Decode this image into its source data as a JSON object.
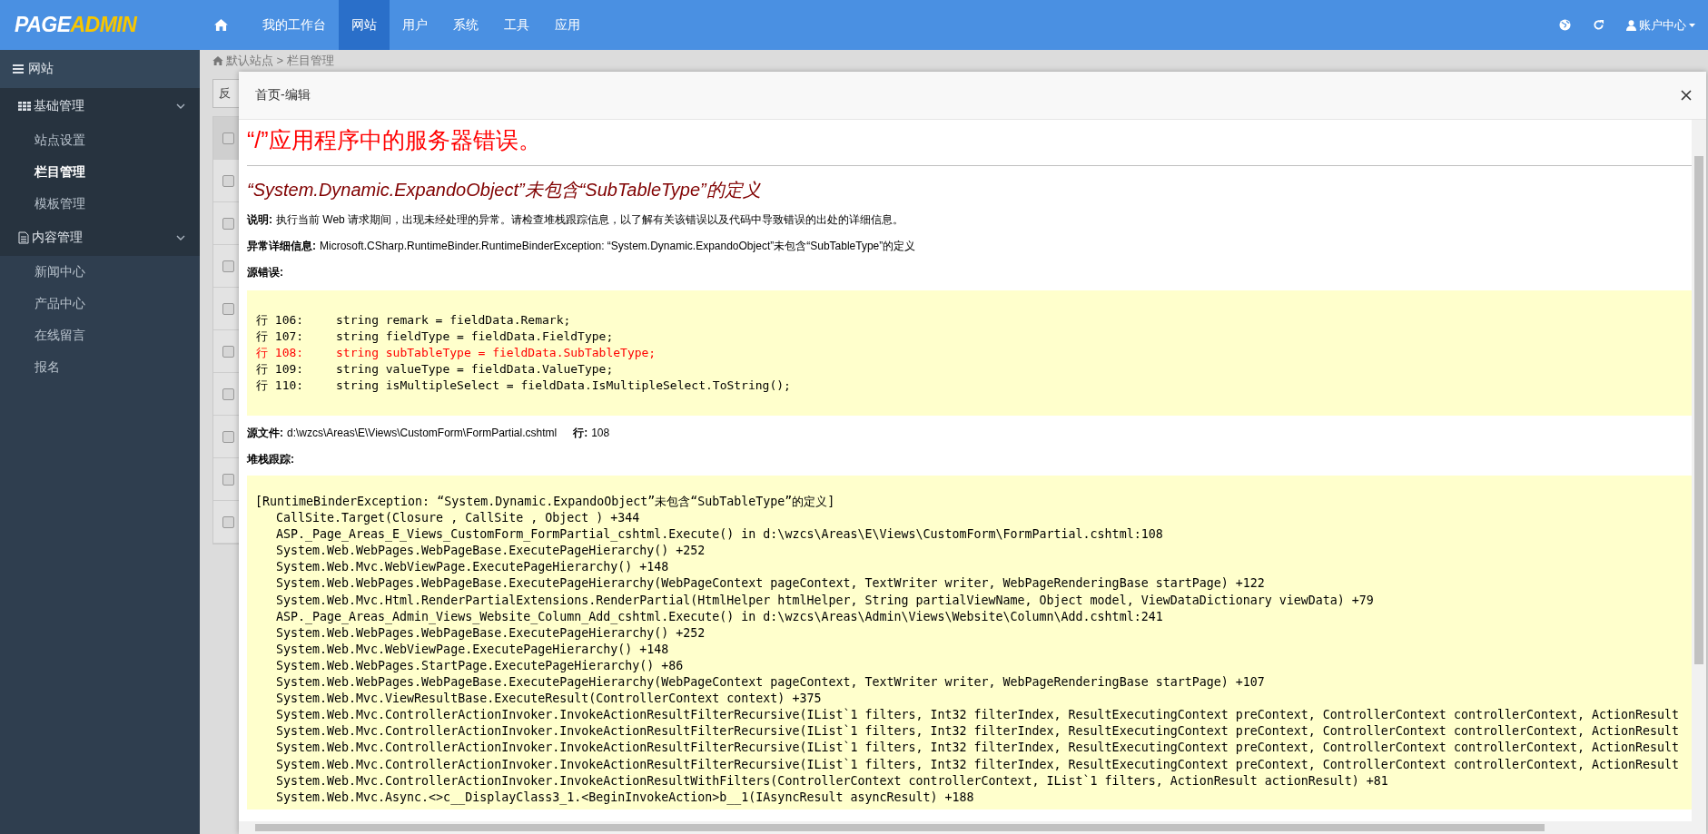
{
  "brand": {
    "first": "PAGE",
    "second": "ADMIN"
  },
  "top_nav": [
    {
      "label": "我的工作台",
      "selected": false
    },
    {
      "label": "网站",
      "selected": true
    },
    {
      "label": "用户",
      "selected": false
    },
    {
      "label": "系统",
      "selected": false
    },
    {
      "label": "工具",
      "selected": false
    },
    {
      "label": "应用",
      "selected": false
    }
  ],
  "account": {
    "label": "账户中心"
  },
  "sidebar": {
    "title": "网站",
    "groups": [
      {
        "label": "基础管理",
        "expanded": true,
        "items": [
          {
            "label": "站点设置",
            "selected": false
          },
          {
            "label": "栏目管理",
            "selected": true
          },
          {
            "label": "模板管理",
            "selected": false
          }
        ]
      },
      {
        "label": "内容管理",
        "expanded": true,
        "items": [
          {
            "label": "新闻中心",
            "selected": false
          },
          {
            "label": "产品中心",
            "selected": false
          },
          {
            "label": "在线留言",
            "selected": false
          },
          {
            "label": "报名",
            "selected": false
          }
        ]
      }
    ]
  },
  "breadcrumb": "默认站点 > 栏目管理",
  "list": {
    "button": "反",
    "rows": [
      {
        "checked": false
      },
      {
        "checked": false
      },
      {
        "checked": false
      },
      {
        "checked": false
      },
      {
        "checked": false
      },
      {
        "checked": false
      },
      {
        "checked": false
      },
      {
        "checked": false
      },
      {
        "checked": false
      },
      {
        "checked": false
      }
    ]
  },
  "modal": {
    "title": "首页-编辑",
    "heading": "“/”应用程序中的服务器错误。",
    "subheading": "“System.Dynamic.ExpandoObject”未包含“SubTableType”的定义",
    "description": {
      "label": "说明:",
      "text": "执行当前 Web 请求期间，出现未经处理的异常。请检查堆栈跟踪信息，以了解有关该错误以及代码中导致错误的出处的详细信息。"
    },
    "details": {
      "label": "异常详细信息:",
      "text": "Microsoft.CSharp.RuntimeBinder.RuntimeBinderException: “System.Dynamic.ExpandoObject”未包含“SubTableType”的定义"
    },
    "source_error_label": "源错误:",
    "code_lines": [
      {
        "line": "行 106:",
        "code": "string remark = fieldData.Remark;",
        "highlighted": false
      },
      {
        "line": "行 107:",
        "code": "string fieldType = fieldData.FieldType;",
        "highlighted": false
      },
      {
        "line": "行 108:",
        "code": "string subTableType = fieldData.SubTableType;",
        "highlighted": true
      },
      {
        "line": "行 109:",
        "code": "string valueType = fieldData.ValueType;",
        "highlighted": false
      },
      {
        "line": "行 110:",
        "code": "string isMultipleSelect = fieldData.IsMultipleSelect.ToString();",
        "highlighted": false
      }
    ],
    "source_file": {
      "label": "源文件:",
      "path": "d:\\wzcs\\Areas\\E\\Views\\CustomForm\\FormPartial.cshtml",
      "line_label": "行:",
      "line": "108"
    },
    "stack_label": "堆栈跟踪:",
    "stack_header": "[RuntimeBinderException: “System.Dynamic.ExpandoObject”未包含“SubTableType”的定义]",
    "stack_frames": [
      "CallSite.Target(Closure , CallSite , Object ) +344",
      "ASP._Page_Areas_E_Views_CustomForm_FormPartial_cshtml.Execute() in d:\\wzcs\\Areas\\E\\Views\\CustomForm\\FormPartial.cshtml:108",
      "System.Web.WebPages.WebPageBase.ExecutePageHierarchy() +252",
      "System.Web.Mvc.WebViewPage.ExecutePageHierarchy() +148",
      "System.Web.WebPages.WebPageBase.ExecutePageHierarchy(WebPageContext pageContext, TextWriter writer, WebPageRenderingBase startPage) +122",
      "System.Web.Mvc.Html.RenderPartialExtensions.RenderPartial(HtmlHelper htmlHelper, String partialViewName, Object model, ViewDataDictionary viewData) +79",
      "ASP._Page_Areas_Admin_Views_Website_Column_Add_cshtml.Execute() in d:\\wzcs\\Areas\\Admin\\Views\\Website\\Column\\Add.cshtml:241",
      "System.Web.WebPages.WebPageBase.ExecutePageHierarchy() +252",
      "System.Web.Mvc.WebViewPage.ExecutePageHierarchy() +148",
      "System.Web.WebPages.StartPage.ExecutePageHierarchy() +86",
      "System.Web.WebPages.WebPageBase.ExecutePageHierarchy(WebPageContext pageContext, TextWriter writer, WebPageRenderingBase startPage) +107",
      "System.Web.Mvc.ViewResultBase.ExecuteResult(ControllerContext context) +375",
      "System.Web.Mvc.ControllerActionInvoker.InvokeActionResultFilterRecursive(IList`1 filters, Int32 filterIndex, ResultExecutingContext preContext, ControllerContext controllerContext, ActionResult",
      "System.Web.Mvc.ControllerActionInvoker.InvokeActionResultFilterRecursive(IList`1 filters, Int32 filterIndex, ResultExecutingContext preContext, ControllerContext controllerContext, ActionResult",
      "System.Web.Mvc.ControllerActionInvoker.InvokeActionResultFilterRecursive(IList`1 filters, Int32 filterIndex, ResultExecutingContext preContext, ControllerContext controllerContext, ActionResult",
      "System.Web.Mvc.ControllerActionInvoker.InvokeActionResultFilterRecursive(IList`1 filters, Int32 filterIndex, ResultExecutingContext preContext, ControllerContext controllerContext, ActionResult",
      "System.Web.Mvc.ControllerActionInvoker.InvokeActionResultWithFilters(ControllerContext controllerContext, IList`1 filters, ActionResult actionResult) +81",
      "System.Web.Mvc.Async.<>c__DisplayClass3_1.<BeginInvokeAction>b__1(IAsyncResult asyncResult) +188"
    ]
  }
}
